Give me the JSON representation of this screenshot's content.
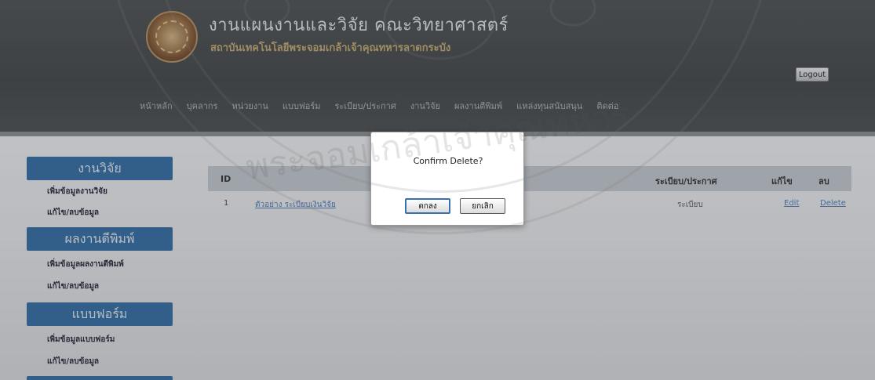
{
  "header": {
    "title": "งานแผนงานและวิจัย คณะวิทยาศาสตร์",
    "subtitle": "สถาบันเทคโนโลยีพระจอมเกล้าเจ้าคุณทหารลาดกระบัง",
    "logout_label": "Logout",
    "nav": [
      "หน้าหลัก",
      "บุคลากร",
      "หน่วยงาน",
      "แบบฟอร์ม",
      "ระเบียบ/ประกาศ",
      "งานวิจัย",
      "ผลงานตีพิมพ์",
      "แหล่งทุนสนับสนุน",
      "ติดต่อ"
    ]
  },
  "sidebar": {
    "sections": [
      {
        "title": "งานวิจัย",
        "links": [
          "เพิ่มข้อมูลงานวิจัย",
          "แก้ไข/ลบข้อมูล"
        ]
      },
      {
        "title": "ผลงานตีพิมพ์",
        "links": [
          "เพิ่มข้อมูลผลงานตีพิมพ์",
          "แก้ไข/ลบข้อมูล"
        ]
      },
      {
        "title": "แบบฟอร์ม",
        "links": [
          "เพิ่มข้อมูลแบบฟอร์ม",
          "แก้ไข/ลบข้อมูล"
        ]
      }
    ]
  },
  "table": {
    "headers": {
      "id": "ID",
      "type": "ระเบียบ/ประกาศ",
      "edit": "แก้ไข",
      "delete": "ลบ"
    },
    "rows": [
      {
        "id": "1",
        "title": "ตัวอย่าง ระเบียบเงินวิจัย",
        "type": "ระเบียบ",
        "edit": "Edit",
        "delete": "Delete"
      }
    ]
  },
  "dialog": {
    "message": "Confirm Delete?",
    "ok_label": "ตกลง",
    "cancel_label": "ยกเลิก"
  },
  "watermark": {
    "text": "พระจอมเกล้าเจ้าคุณทหาร"
  },
  "colors": {
    "header": "#434544",
    "sidebar_head": "#2f6aa0",
    "table_head": "#c5c9ce",
    "link": "#4b7bb5"
  }
}
